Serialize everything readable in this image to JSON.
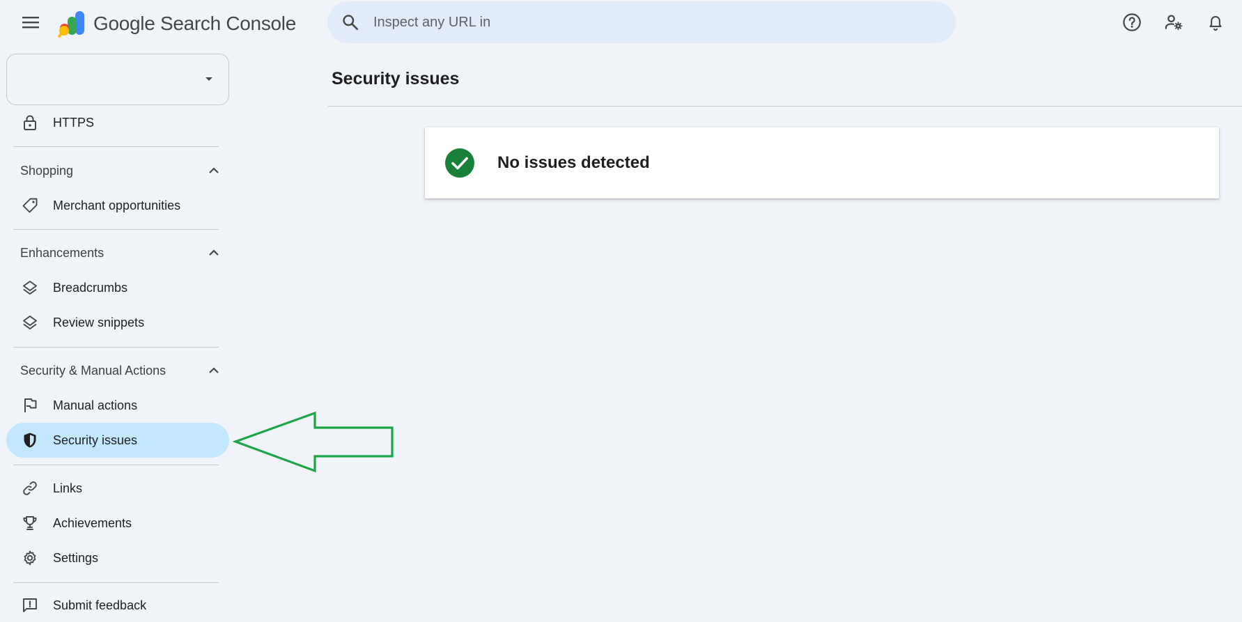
{
  "app": {
    "brand_name": "Google Search Console"
  },
  "search": {
    "placeholder": "Inspect any URL in"
  },
  "sidebar": {
    "property_selector_value": "",
    "items": {
      "https": "HTTPS",
      "merchant_opportunities": "Merchant opportunities",
      "breadcrumbs": "Breadcrumbs",
      "review_snippets": "Review snippets",
      "manual_actions": "Manual actions",
      "security_issues": "Security issues",
      "links": "Links",
      "achievements": "Achievements",
      "settings": "Settings",
      "submit_feedback": "Submit feedback"
    },
    "sections": {
      "shopping": "Shopping",
      "enhancements": "Enhancements",
      "security_manual_actions": "Security & Manual Actions"
    },
    "active_item": "security_issues"
  },
  "main": {
    "title": "Security issues",
    "status_card": {
      "text": "No issues detected",
      "status": "ok"
    }
  },
  "colors": {
    "background": "#f0f4f9",
    "search_bg": "#e2ebfa",
    "active_nav_bg": "#c2e7ff",
    "success_green": "#188038",
    "annotation_arrow": "#1ea446",
    "brand_blue": "#4285f4",
    "brand_green": "#34a853",
    "brand_yellow": "#fbbc04",
    "brand_red": "#ea4335"
  },
  "icons": {
    "menu": "hamburger-menu-icon",
    "search": "search-icon",
    "help": "help-circle-icon",
    "admin": "manage-accounts-icon",
    "notifications": "bell-icon",
    "status": "check-circle-icon"
  }
}
